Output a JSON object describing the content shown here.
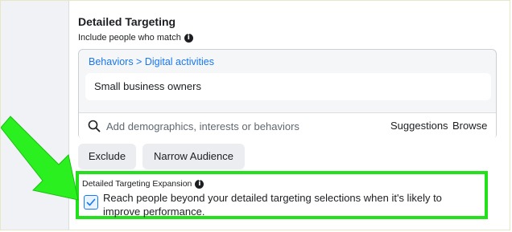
{
  "section": {
    "title": "Detailed Targeting",
    "subtitle": "Include people who match",
    "info_icon": "info-icon"
  },
  "targeting": {
    "breadcrumb": "Behaviors > Digital activities",
    "selection": "Small business owners",
    "search_placeholder": "Add demographics, interests or behaviors",
    "suggestions_label": "Suggestions",
    "browse_label": "Browse"
  },
  "actions": {
    "exclude_label": "Exclude",
    "narrow_label": "Narrow Audience"
  },
  "expansion": {
    "label": "Detailed Targeting Expansion",
    "text": "Reach people beyond your detailed targeting selections when it's likely to improve performance.",
    "checked": true
  },
  "colors": {
    "link": "#1877f2",
    "highlight": "#22e01a",
    "sidebar_bg": "#f0f2f5"
  }
}
